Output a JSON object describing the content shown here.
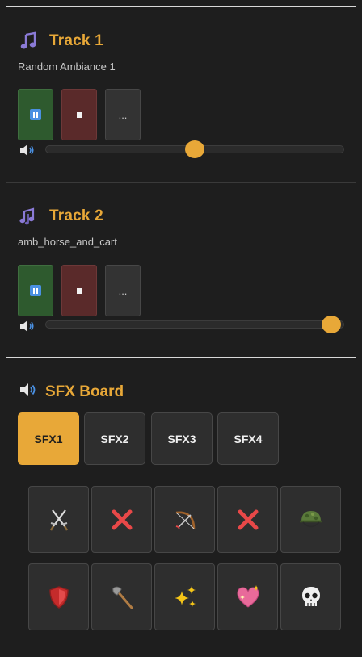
{
  "tracks": [
    {
      "title": "Track 1",
      "subtitle": "Random Ambiance 1",
      "icon": "music-note-icon",
      "more_label": "...",
      "volume": 0.5
    },
    {
      "title": "Track 2",
      "subtitle": "amb_horse_and_cart",
      "icon": "music-notes-icon",
      "more_label": "...",
      "volume": 0.96
    }
  ],
  "sfx_board": {
    "title": "SFX Board",
    "icon": "speaker-icon",
    "tabs": [
      "SFX1",
      "SFX2",
      "SFX3",
      "SFX4"
    ],
    "active_tab": "SFX1",
    "sounds": [
      "crossed-swords-icon",
      "cross-mark-icon",
      "bow-and-arrow-icon",
      "cross-mark-icon",
      "military-helmet-icon",
      "shield-icon",
      "axe-icon",
      "sparkles-icon",
      "sparkling-heart-icon",
      "skull-icon"
    ]
  },
  "colors": {
    "accent": "#e8a838",
    "play": "#2e5a2e",
    "stop": "#5a2a2a",
    "background": "#1e1e1e"
  }
}
